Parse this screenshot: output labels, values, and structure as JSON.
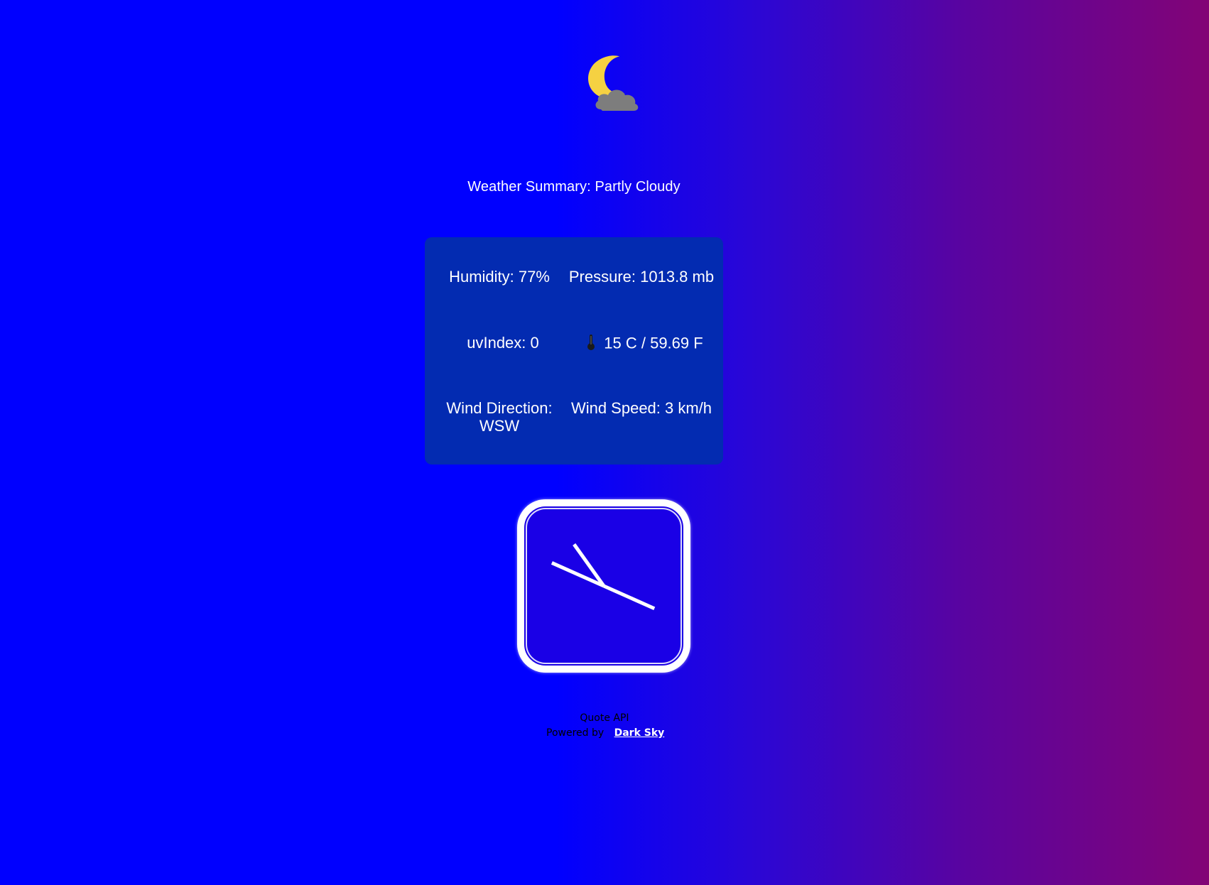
{
  "icon": {
    "name": "partly-cloudy-night-icon",
    "moon_color": "#f5d142",
    "cloud_color": "#808080"
  },
  "summary": {
    "label": "Weather Summary:",
    "value": "Partly Cloudy"
  },
  "stats": {
    "humidity": "Humidity: 77%",
    "pressure": "Pressure: 1013.8 mb",
    "uv_index": "uvIndex: 0",
    "temperature": "15 C / 59.69 F",
    "wind_direction_label": "Wind Direction:",
    "wind_direction_value": "WSW",
    "wind_speed": "Wind Speed: 3 km/h"
  },
  "clock": {
    "hour": 10,
    "minute": 49
  },
  "footer": {
    "quote": "Quote API",
    "powered_by": "Powered by",
    "link_text": "Dark Sky"
  },
  "colors": {
    "background_left": "#0000ff",
    "background_right": "#820476",
    "panel": "#032bb1",
    "clock_face": "#1a00e6"
  }
}
